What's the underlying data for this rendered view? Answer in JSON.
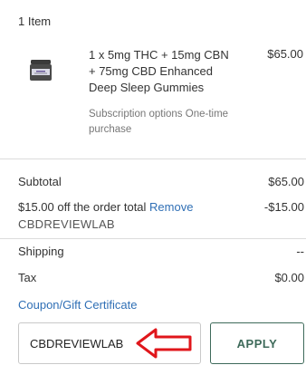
{
  "cart": {
    "item_count": "1 Item",
    "product": {
      "name": "1 x 5mg THC + 15mg CBN + 75mg CBD Enhanced Deep Sleep Gummies",
      "options": "Subscription options One-time purchase",
      "price": "$65.00",
      "thumbnail_icon": "product-jar-icon"
    }
  },
  "summary": {
    "subtotal_label": "Subtotal",
    "subtotal_value": "$65.00",
    "discount_label": "$15.00 off the order total",
    "remove_label": "Remove",
    "discount_value": "-$15.00",
    "discount_code": "CBDREVIEWLAB",
    "shipping_label": "Shipping",
    "shipping_value": "--",
    "tax_label": "Tax",
    "tax_value": "$0.00",
    "coupon_link": "Coupon/Gift Certificate"
  },
  "coupon": {
    "input_value": "CBDREVIEWLAB",
    "apply_label": "APPLY",
    "annotation_icon": "red-arrow-icon",
    "annotation_color": "#e0161b"
  },
  "colors": {
    "link": "#2f6fb5",
    "apply_border": "#3e6a5a"
  }
}
